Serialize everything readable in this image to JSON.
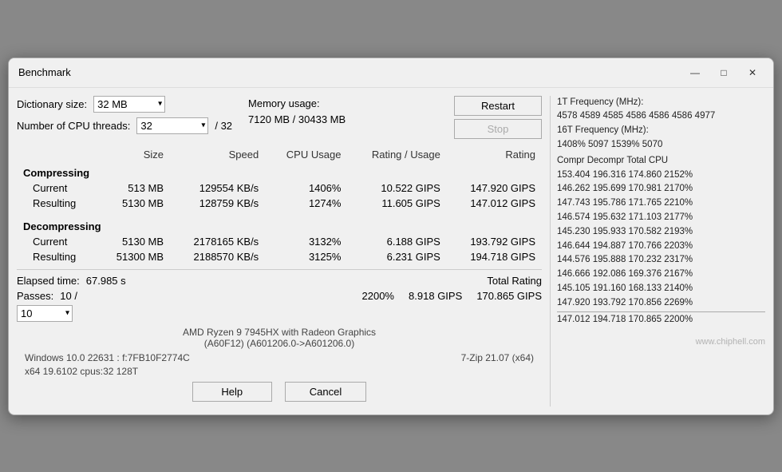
{
  "titlebar": {
    "title": "Benchmark",
    "minimize_label": "—",
    "maximize_label": "□",
    "close_label": "✕"
  },
  "controls": {
    "dictionary_size_label": "Dictionary size:",
    "dictionary_size_value": "32 MB",
    "cpu_threads_label": "Number of CPU threads:",
    "cpu_threads_value": "32",
    "cpu_threads_suffix": "/ 32",
    "memory_usage_label": "Memory usage:",
    "memory_usage_value": "7120 MB / 30433 MB",
    "restart_label": "Restart",
    "stop_label": "Stop"
  },
  "table": {
    "headers": [
      "",
      "Size",
      "Speed",
      "CPU Usage",
      "Rating / Usage",
      "Rating"
    ],
    "compressing_label": "Compressing",
    "decompressing_label": "Decompressing",
    "rows": {
      "comp_current": [
        "Current",
        "513 MB",
        "129554 KB/s",
        "1406%",
        "10.522 GIPS",
        "147.920 GIPS"
      ],
      "comp_resulting": [
        "Resulting",
        "5130 MB",
        "128759 KB/s",
        "1274%",
        "11.605 GIPS",
        "147.012 GIPS"
      ],
      "decomp_current": [
        "Current",
        "5130 MB",
        "2178165 KB/s",
        "3132%",
        "6.188 GIPS",
        "193.792 GIPS"
      ],
      "decomp_resulting": [
        "Resulting",
        "51300 MB",
        "2188570 KB/s",
        "3125%",
        "6.231 GIPS",
        "194.718 GIPS"
      ]
    }
  },
  "bottom": {
    "elapsed_label": "Elapsed time:",
    "elapsed_value": "67.985 s",
    "passes_label": "Passes:",
    "passes_value": "10 /",
    "passes_select": "10",
    "total_rating_label": "Total Rating",
    "total_rating_percent": "2200%",
    "total_rating_gips1": "8.918 GIPS",
    "total_rating_gips2": "170.865 GIPS"
  },
  "footer": {
    "windows_info": "Windows 10.0 22631 :  f:7FB10F2774C",
    "zip_info": "7-Zip 21.07 (x64)",
    "cpu_info": "x64 19.6102 cpus:32 128T",
    "cpu_model": "AMD Ryzen 9 7945HX with Radeon Graphics",
    "cpu_ids": "(A60F12) (A601206.0->A601206.0)",
    "help_label": "Help",
    "cancel_label": "Cancel",
    "chiphell": "www.chiphell.com"
  },
  "right_panel": {
    "freq_1t_label": "1T Frequency (MHz):",
    "freq_1t_values": "4578 4589 4585 4586 4586 4586 4977",
    "freq_16t_label": "16T Frequency (MHz):",
    "freq_16t_values": "1408% 5097 1539% 5070",
    "col_headers": "Compr Decompr Total  CPU",
    "rows": [
      "153.404  196.316  174.860  2152%",
      "146.262  195.699  170.981  2170%",
      "147.743  195.786  171.765  2210%",
      "146.574  195.632  171.103  2177%",
      "145.230  195.933  170.582  2193%",
      "146.644  194.887  170.766  2203%",
      "144.576  195.888  170.232  2317%",
      "146.666  192.086  169.376  2167%",
      "145.105  191.160  168.133  2140%",
      "147.920  193.792  170.856  2269%"
    ],
    "divider": "-------------",
    "total_row": "147.012  194.718  170.865  2200%"
  }
}
